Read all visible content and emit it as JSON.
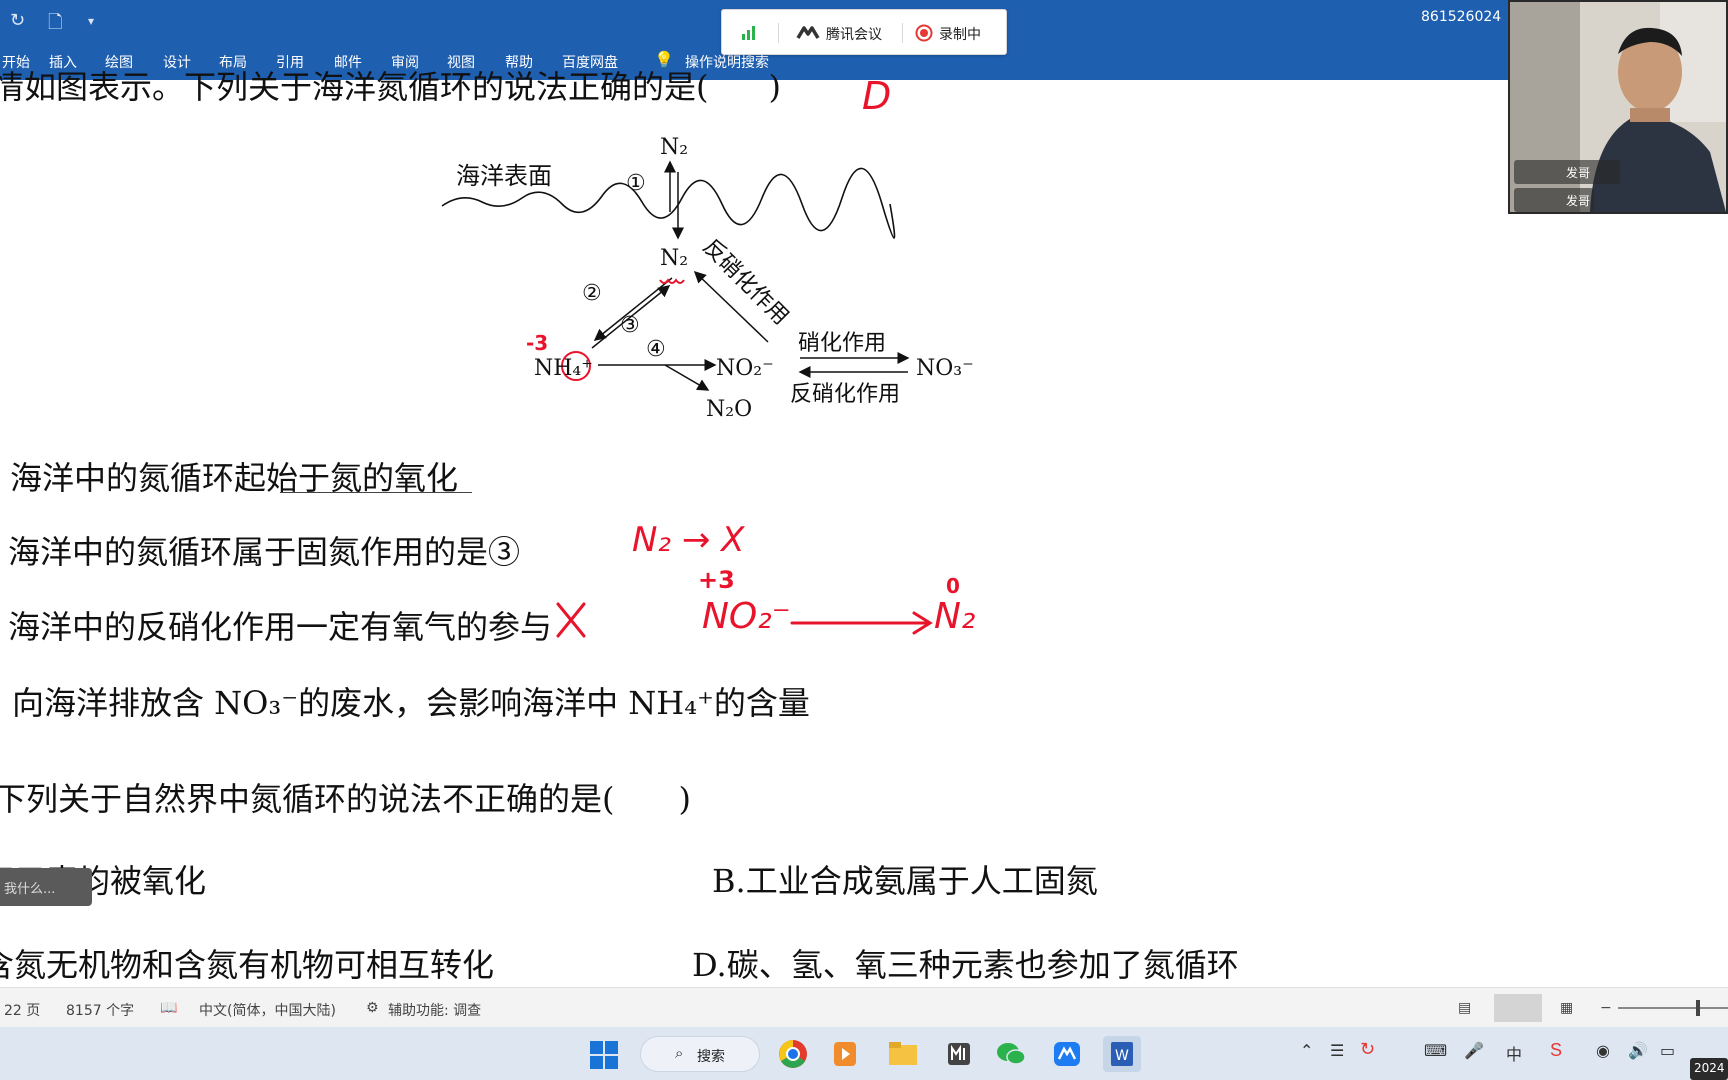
{
  "word": {
    "tabs": [
      "开始",
      "插入",
      "绘图",
      "设计",
      "布局",
      "引用",
      "邮件",
      "审阅",
      "视图",
      "帮助",
      "百度网盘",
      "操作说明搜索"
    ],
    "phone_number": "861526024"
  },
  "meeting": {
    "app_name": "腾讯会议",
    "recording_label": "录制中"
  },
  "document": {
    "question_fragment": "情如图表示。下列关于海洋氮循环的说法正确的是(",
    "question_close": ")",
    "handwritten_answer": "D",
    "diagram": {
      "sea_surface": "海洋表面",
      "n2_top": "N₂",
      "n2_mid": "N₂",
      "step1": "①",
      "step2": "②",
      "step3": "③",
      "step4": "④",
      "denitrification_diag": "反硝化作用",
      "nh4": "NH₄⁺",
      "no2": "NO₂⁻",
      "n2o": "N₂O",
      "nitrification": "硝化作用",
      "denitrification": "反硝化作用",
      "no3": "NO₃⁻",
      "charge_note": "-3"
    },
    "options": [
      "海洋中的氮循环起始于氮的氧化",
      "海洋中的氮循环属于固氮作用的是③",
      "海洋中的反硝化作用一定有氧气的参与",
      "向海洋排放含 NO₃⁻的废水，会影响海洋中 NH₄⁺的含量"
    ],
    "annotations": {
      "n2_to_x": "N₂ → X",
      "plus3": "+3",
      "no2_minus": "NO₂⁻",
      "zero": "0",
      "n2_result": "N₂"
    },
    "question2": "下列关于自然界中氮循环的说法不正确的是(　　)",
    "q2_options": {
      "a": "氮元素均被氧化",
      "b": "B.工业合成氨属于人工固氮",
      "c": "含氮无机物和含氮有机物可相互转化",
      "d": "D.碳、氢、氧三种元素也参加了氮循环"
    },
    "popup_text": "我什么..."
  },
  "status": {
    "pages": "22 页",
    "words": "8157 个字",
    "language": "中文(简体，中国大陆)",
    "accessibility": "辅助功能: 调查"
  },
  "taskbar": {
    "search_label": "搜索",
    "clock": "2024"
  },
  "webcam": {
    "participant_1": "发哥",
    "participant_2": "发哥"
  }
}
